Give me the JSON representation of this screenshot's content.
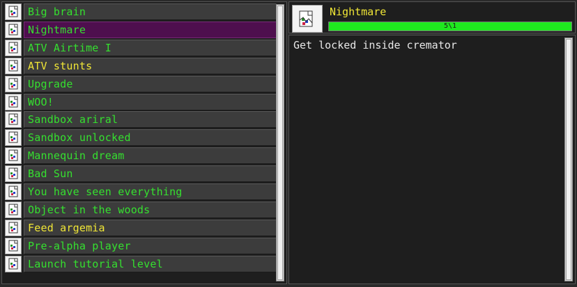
{
  "achievements": [
    {
      "label": "Big brain",
      "color": "#35e02f",
      "icon": "broken-image-icon"
    },
    {
      "label": "Nightmare",
      "color": "#35e02f",
      "icon": "broken-image-icon",
      "selected": true
    },
    {
      "label": "ATV Airtime I",
      "color": "#35e02f",
      "icon": "broken-image-icon"
    },
    {
      "label": "ATV stunts",
      "color": "#f0e636",
      "icon": "broken-image-icon"
    },
    {
      "label": "Upgrade",
      "color": "#35e02f",
      "icon": "broken-image-icon"
    },
    {
      "label": "WOO!",
      "color": "#35e02f",
      "icon": "broken-image-icon"
    },
    {
      "label": "Sandbox ariral",
      "color": "#35e02f",
      "icon": "broken-image-icon"
    },
    {
      "label": "Sandbox unlocked",
      "color": "#35e02f",
      "icon": "broken-image-icon"
    },
    {
      "label": "Mannequin dream",
      "color": "#35e02f",
      "icon": "broken-image-icon"
    },
    {
      "label": "Bad Sun",
      "color": "#35e02f",
      "icon": "broken-image-icon"
    },
    {
      "label": "You have seen everything",
      "color": "#35e02f",
      "icon": "broken-image-icon"
    },
    {
      "label": "Object in the woods",
      "color": "#35e02f",
      "icon": "broken-image-icon"
    },
    {
      "label": "Feed argemia",
      "color": "#f0e636",
      "icon": "broken-image-icon"
    },
    {
      "label": "Pre-alpha player",
      "color": "#35e02f",
      "icon": "broken-image-icon"
    },
    {
      "label": "Launch tutorial level",
      "color": "#35e02f",
      "icon": "broken-image-icon"
    }
  ],
  "detail": {
    "title": "Nightmare",
    "title_color": "#f0e636",
    "progress_text": "5\\1",
    "progress_fraction": 1.0,
    "progress_color": "#1fe81f",
    "description": "Get locked inside cremator",
    "icon": "broken-image-icon"
  },
  "colors": {
    "selected_row": "#4e0f4e",
    "row_bg": "#3c3c3c",
    "panel_bg": "#1e1e1e"
  }
}
